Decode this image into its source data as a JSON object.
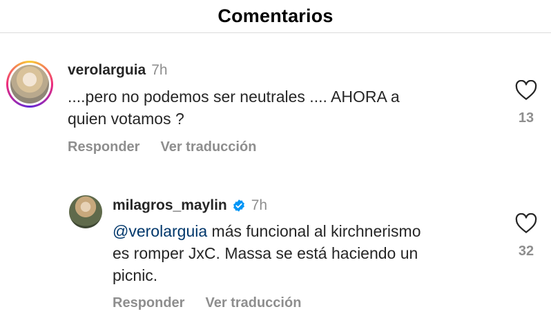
{
  "header": {
    "title": "Comentarios"
  },
  "comments": [
    {
      "username": "verolarguia",
      "time": "7h",
      "text_lines": [
        "....pero no podemos ser neutrales .... AHORA a",
        "quien votamos ?"
      ],
      "reply_label": "Responder",
      "translate_label": "Ver traducción",
      "likes": "13",
      "has_story_ring": true
    },
    {
      "username": "milagros_maylin",
      "verified": true,
      "time": "7h",
      "mention": "@verolarguia",
      "text_lines": [
        " más funcional al kirchnerismo",
        "es romper JxC. Massa se está haciendo un",
        "picnic."
      ],
      "reply_label": "Responder",
      "translate_label": "Ver traducción",
      "likes": "32",
      "colors": {
        "verified_badge": "#0095f6",
        "mention": "#00376b"
      }
    }
  ]
}
